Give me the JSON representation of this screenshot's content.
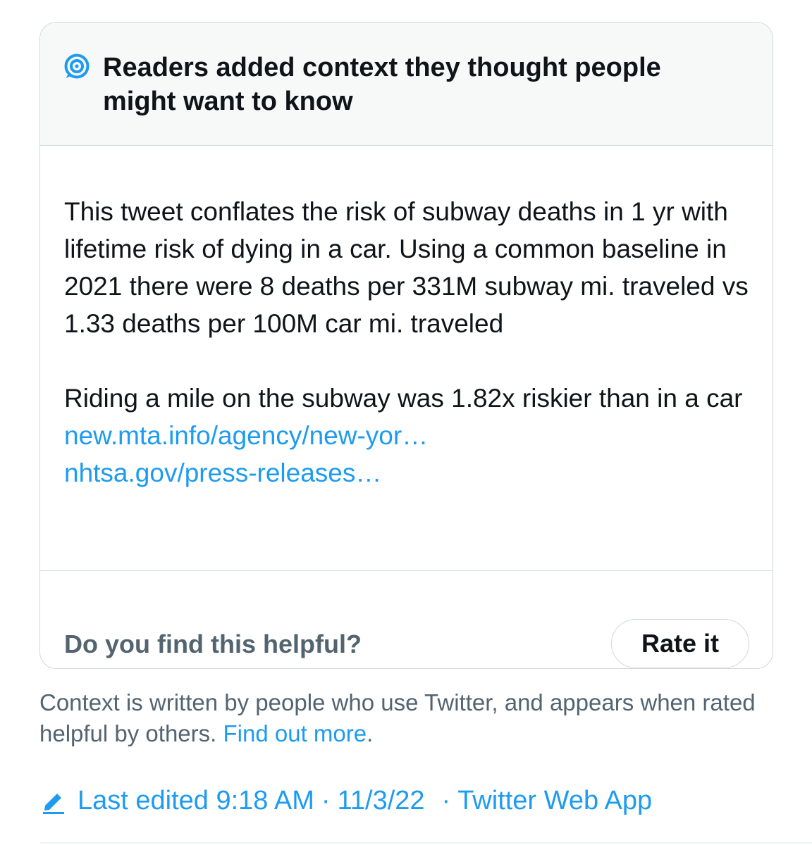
{
  "note": {
    "header_icon": "community-notes-icon",
    "header_title": "Readers added context they thought people might want to know",
    "body_paragraph_1": "This tweet conflates the risk of subway deaths in 1 yr with lifetime risk of dying in a car. Using a common baseline in 2021 there were 8 deaths per 331M subway mi. traveled vs 1.33 deaths per 100M car mi. traveled",
    "body_paragraph_2": "Riding a mile on the subway was 1.82x riskier than in a car",
    "links": [
      "new.mta.info/agency/new-yor…",
      "nhtsa.gov/press-releases…"
    ],
    "footer_question": "Do you find this helpful?",
    "rate_button_label": "Rate it"
  },
  "disclaimer": {
    "text": "Context is written by people who use Twitter, and appears when rated helpful by others.",
    "link_label": "Find out more",
    "trailing": "."
  },
  "edited": {
    "icon": "pencil-icon",
    "label": "Last edited 9:18 AM",
    "separator": "·",
    "date": "11/3/22",
    "source": "Twitter Web App"
  },
  "colors": {
    "accent": "#1d9bf0",
    "text_primary": "#0f1419",
    "text_secondary": "#536471",
    "border": "#cfd9de",
    "header_bg": "#f7f9f9"
  }
}
